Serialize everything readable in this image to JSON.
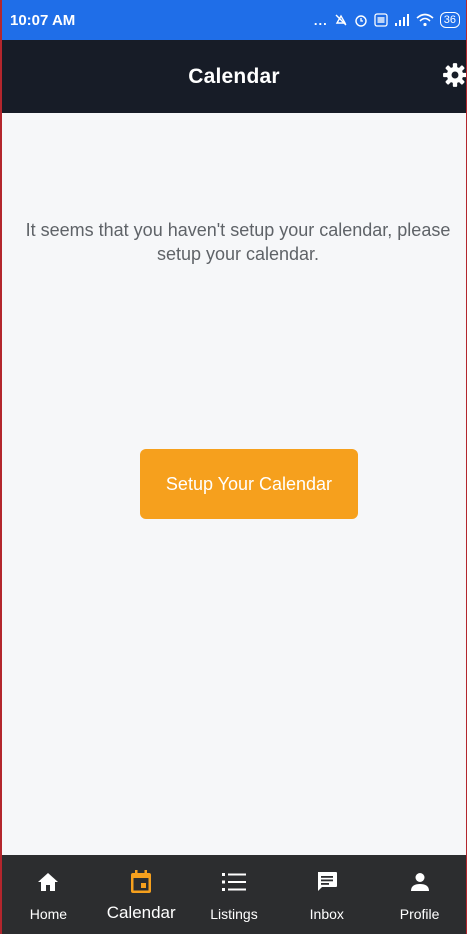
{
  "status_bar": {
    "time": "10:07 AM",
    "signal_text": "...",
    "battery": "36"
  },
  "app_bar": {
    "title": "Calendar"
  },
  "main": {
    "message": "It seems that you haven't setup your calendar, please setup your calendar.",
    "setup_button_label": "Setup Your Calendar"
  },
  "bottom_nav": {
    "items": [
      {
        "label": "Home",
        "icon": "home-icon"
      },
      {
        "label": "Calendar",
        "icon": "calendar-icon",
        "active": true
      },
      {
        "label": "Listings",
        "icon": "list-icon"
      },
      {
        "label": "Inbox",
        "icon": "message-icon"
      },
      {
        "label": "Profile",
        "icon": "person-icon"
      }
    ]
  },
  "colors": {
    "status_bar": "#1f6ee8",
    "app_bar": "#171c27",
    "accent": "#f6a01d",
    "nav_bar": "#2c2d2f",
    "background": "#f6f7f9"
  }
}
